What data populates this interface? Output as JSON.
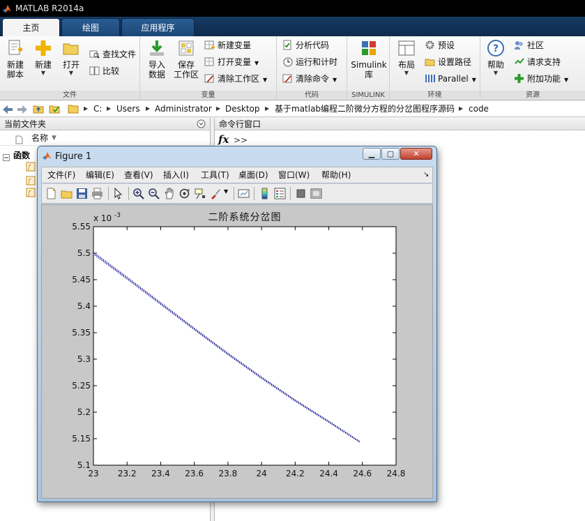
{
  "app": {
    "title": "MATLAB R2014a"
  },
  "ribbon_tabs": [
    {
      "label": "主页",
      "active": true
    },
    {
      "label": "绘图",
      "active": false
    },
    {
      "label": "应用程序",
      "active": false
    }
  ],
  "ribbon": {
    "file": {
      "label": "文件",
      "new_script_line1": "新建",
      "new_script_line2": "脚本",
      "new": "新建",
      "open": "打开",
      "find_files": "查找文件",
      "compare": "比较"
    },
    "variable": {
      "label": "变量",
      "import_line1": "导入",
      "import_line2": "数据",
      "save_line1": "保存",
      "save_line2": "工作区",
      "new_var": "新建变量",
      "open_var": "打开变量",
      "clear_ws": "清除工作区"
    },
    "code": {
      "label": "代码",
      "analyze": "分析代码",
      "run_time": "运行和计时",
      "clear_cmd": "清除命令"
    },
    "simulink": {
      "label": "SIMULINK",
      "btn_line1": "Simulink",
      "btn_line2": "库"
    },
    "env": {
      "label": "环境",
      "layout": "布局",
      "prefs": "预设",
      "set_path": "设置路径",
      "parallel": "Parallel"
    },
    "resources": {
      "label": "资源",
      "help": "帮助",
      "community": "社区",
      "support": "请求支持",
      "addons": "附加功能"
    }
  },
  "address": {
    "crumbs": [
      "C:",
      "Users",
      "Administrator",
      "Desktop",
      "基于matlab编程二阶微分方程的分岔图程序源码",
      "code"
    ]
  },
  "left_panel": {
    "title": "当前文件夹",
    "name_col": "名称",
    "group": "函数"
  },
  "cmd_panel": {
    "title": "命令行窗口",
    "fx": "fx",
    "prompt": ">>"
  },
  "figure": {
    "title": "Figure 1",
    "menus": [
      "文件(F)",
      "编辑(E)",
      "查看(V)",
      "插入(I)",
      "工具(T)",
      "桌面(D)",
      "窗口(W)",
      "帮助(H)"
    ]
  },
  "chart_data": {
    "type": "scatter",
    "title": "二阶系统分岔图",
    "xlabel": "",
    "ylabel": "",
    "xlim": [
      23,
      24.8
    ],
    "ylim": [
      5.1,
      5.55
    ],
    "x_ticks": [
      "23",
      "23.2",
      "23.4",
      "23.6",
      "23.8",
      "24",
      "24.2",
      "24.4",
      "24.6",
      "24.8"
    ],
    "y_ticks": [
      "5.1",
      "5.15",
      "5.2",
      "5.25",
      "5.3",
      "5.35",
      "5.4",
      "5.45",
      "5.5",
      "5.55"
    ],
    "y_exponent_base": "x 10",
    "y_exponent": "-3",
    "series": [
      {
        "color": "#00008b",
        "marker": "point",
        "x_start": 23.0,
        "x_end": 24.58,
        "x_step": 0.01,
        "anchors": [
          {
            "x": 23.0,
            "y": 5.5
          },
          {
            "x": 23.2,
            "y": 5.453
          },
          {
            "x": 23.4,
            "y": 5.405
          },
          {
            "x": 23.6,
            "y": 5.357
          },
          {
            "x": 23.8,
            "y": 5.31
          },
          {
            "x": 24.0,
            "y": 5.265
          },
          {
            "x": 24.2,
            "y": 5.222
          },
          {
            "x": 24.4,
            "y": 5.182
          },
          {
            "x": 24.58,
            "y": 5.145
          }
        ],
        "spread": 0.004
      }
    ],
    "grid": false,
    "legend": "none"
  }
}
